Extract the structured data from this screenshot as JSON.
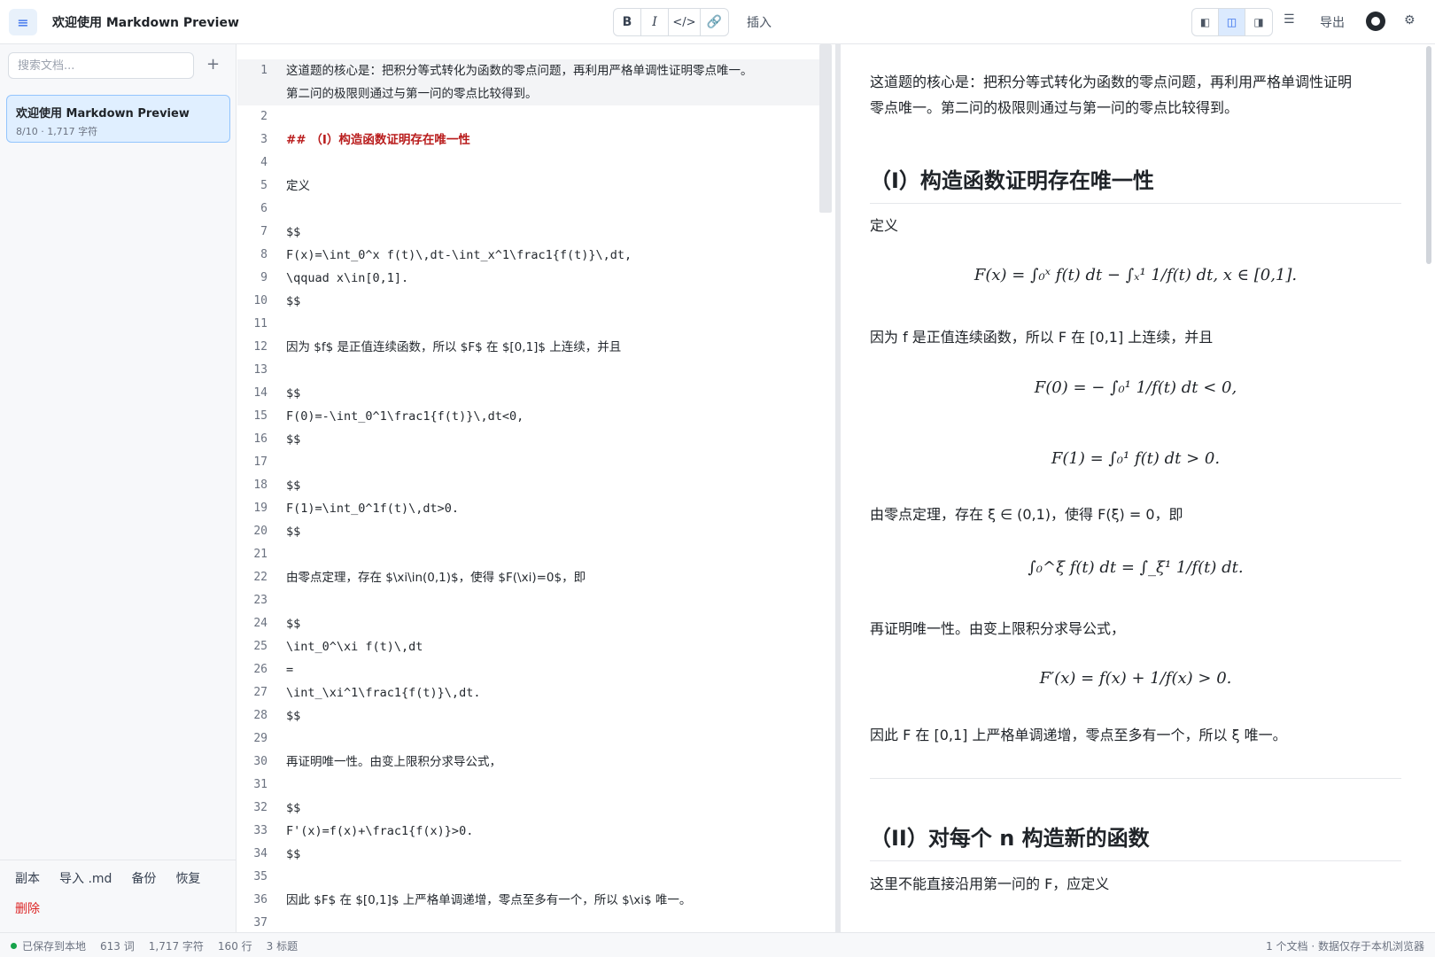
{
  "header": {
    "title": "欢迎使用 Markdown Preview",
    "format_buttons": [
      "B",
      "I",
      "</>",
      "🔗"
    ],
    "insert_label": "插入",
    "view_icons": [
      "◧",
      "◫",
      "◨"
    ],
    "toc_icon": "☰",
    "export_label": "导出",
    "gear_icon": "⚙"
  },
  "sidebar": {
    "search_placeholder": "搜索文档...",
    "add_label": "+",
    "doc": {
      "title": "欢迎使用 Markdown Preview",
      "meta": "8/10 · 1,717 字符"
    },
    "footer": {
      "copy": "副本",
      "import": "导入 .md",
      "backup": "备份",
      "restore": "恢复",
      "delete": "删除"
    }
  },
  "editor": {
    "lines": [
      {
        "n": "1",
        "t": "这道题的核心是：把积分等式转化为函数的零点问题，再利用严格单调性证明零点唯一。",
        "cjk": true
      },
      {
        "n": "",
        "t": "第二问的极限则通过与第一问的零点比较得到。",
        "cjk": true
      },
      {
        "n": "2",
        "t": ""
      },
      {
        "n": "3",
        "t": "## （I）构造函数证明存在唯一性",
        "cjk": true,
        "heading": true
      },
      {
        "n": "4",
        "t": ""
      },
      {
        "n": "5",
        "t": "定义",
        "cjk": true
      },
      {
        "n": "6",
        "t": ""
      },
      {
        "n": "7",
        "t": "$$"
      },
      {
        "n": "8",
        "t": "F(x)=\\int_0^x f(t)\\,dt-\\int_x^1\\frac1{f(t)}\\,dt,"
      },
      {
        "n": "9",
        "t": "\\qquad x\\in[0,1]."
      },
      {
        "n": "10",
        "t": "$$"
      },
      {
        "n": "11",
        "t": ""
      },
      {
        "n": "12",
        "t": "因为 $f$ 是正值连续函数，所以 $F$ 在 $[0,1]$ 上连续，并且",
        "cjk": true
      },
      {
        "n": "13",
        "t": ""
      },
      {
        "n": "14",
        "t": "$$"
      },
      {
        "n": "15",
        "t": "F(0)=-\\int_0^1\\frac1{f(t)}\\,dt<0,"
      },
      {
        "n": "16",
        "t": "$$"
      },
      {
        "n": "17",
        "t": ""
      },
      {
        "n": "18",
        "t": "$$"
      },
      {
        "n": "19",
        "t": "F(1)=\\int_0^1f(t)\\,dt>0."
      },
      {
        "n": "20",
        "t": "$$"
      },
      {
        "n": "21",
        "t": ""
      },
      {
        "n": "22",
        "t": "由零点定理，存在 $\\xi\\in(0,1)$，使得 $F(\\xi)=0$，即",
        "cjk": true
      },
      {
        "n": "23",
        "t": ""
      },
      {
        "n": "24",
        "t": "$$"
      },
      {
        "n": "25",
        "t": "\\int_0^\\xi f(t)\\,dt"
      },
      {
        "n": "26",
        "t": "="
      },
      {
        "n": "27",
        "t": "\\int_\\xi^1\\frac1{f(t)}\\,dt."
      },
      {
        "n": "28",
        "t": "$$"
      },
      {
        "n": "29",
        "t": ""
      },
      {
        "n": "30",
        "t": "再证明唯一性。由变上限积分求导公式，",
        "cjk": true
      },
      {
        "n": "31",
        "t": ""
      },
      {
        "n": "32",
        "t": "$$"
      },
      {
        "n": "33",
        "t": "F'(x)=f(x)+\\frac1{f(x)}>0."
      },
      {
        "n": "34",
        "t": "$$"
      },
      {
        "n": "35",
        "t": ""
      },
      {
        "n": "36",
        "t": "因此 $F$ 在 $[0,1]$ 上严格单调递增，零点至多有一个，所以 $\\xi$ 唯一。",
        "cjk": true
      },
      {
        "n": "37",
        "t": ""
      }
    ]
  },
  "preview": {
    "intro_1": "这道题的核心是：把积分等式转化为函数的零点问题，再利用严格单调性证明",
    "intro_2": "零点唯一。第二问的极限则通过与第一问的零点比较得到。",
    "h2_1": "（I）构造函数证明存在唯一性",
    "p_define": "定义",
    "eq1": "F(x) = ∫₀ˣ f(t) dt − ∫ₓ¹ 1/f(t) dt,      x ∈ [0,1].",
    "p_continuous": "因为 f 是正值连续函数，所以 F 在 [0,1] 上连续，并且",
    "eq2": "F(0) = − ∫₀¹ 1/f(t) dt < 0,",
    "eq3": "F(1) = ∫₀¹ f(t) dt > 0.",
    "p_zero": "由零点定理，存在 ξ ∈ (0,1)，使得 F(ξ) = 0，即",
    "eq4": "∫₀^ξ f(t) dt = ∫_ξ¹ 1/f(t) dt.",
    "p_unique": "再证明唯一性。由变上限积分求导公式，",
    "eq5": "F′(x) = f(x) + 1/f(x) > 0.",
    "p_conclude": "因此 F 在 [0,1] 上严格单调递增，零点至多有一个，所以 ξ 唯一。",
    "h2_2": "（II）对每个 n 构造新的函数",
    "p_last": "这里不能直接沿用第一问的 F，应定义"
  },
  "status": {
    "saved": "已保存到本地",
    "words": "613 词",
    "chars": "1,717 字符",
    "lines": "160 行",
    "headings": "3 标题",
    "right": "1 个文档 · 数据仅存于本机浏览器"
  },
  "colors": {
    "accent": "#2563eb",
    "heading": "#b91c1c",
    "danger": "#dc2626",
    "ok": "#16a34a"
  }
}
